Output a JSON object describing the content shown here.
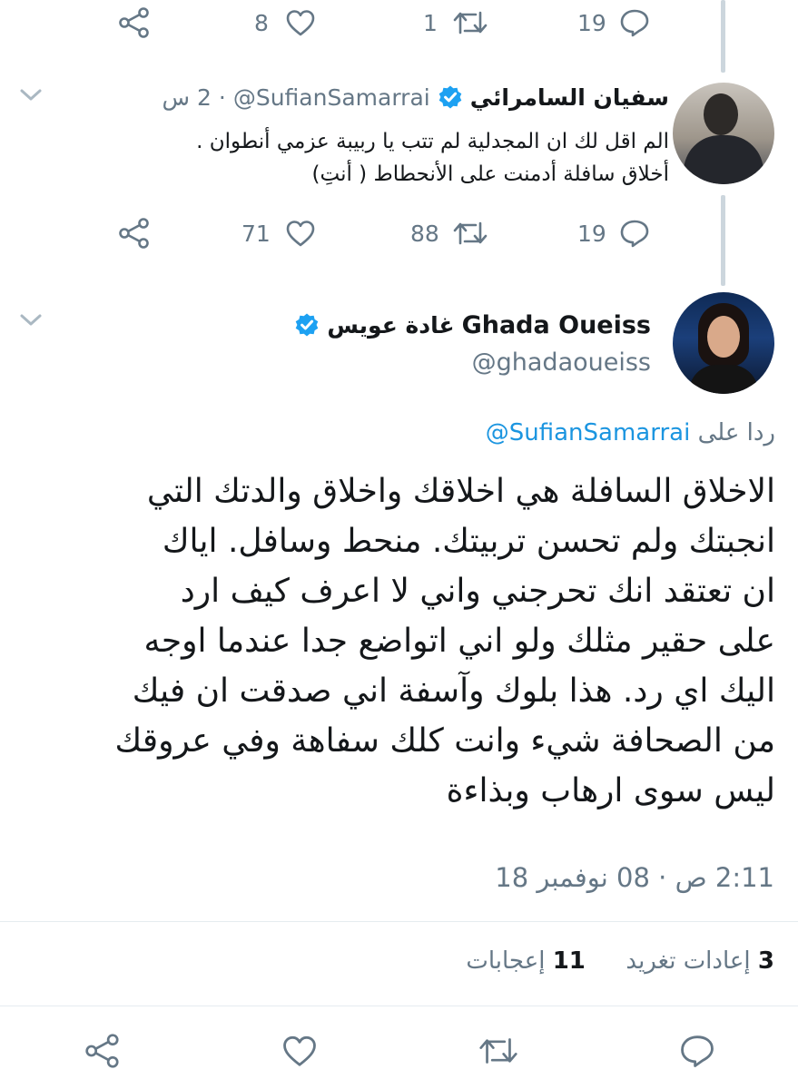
{
  "colors": {
    "accent": "#1b95e0",
    "text": "#14171a",
    "muted": "#657786",
    "divider": "#e6ecf0",
    "thread_line": "#ccd6dd"
  },
  "top_actions": {
    "reply_count": "19",
    "retweet_count": "1",
    "like_count": "8"
  },
  "reply_tweet": {
    "display_name": "سفيان السامرائي",
    "handle": "@SufianSamarrai",
    "time": "2 س",
    "separator": "·",
    "text_lines": [
      "الم اقل لك ان المجدلية لم تتب يا ربيبة عزمي أنطوان .",
      "أخلاق سافلة أدمنت على الأنحطاط ( أنتِ)"
    ],
    "reply_count": "19",
    "retweet_count": "88",
    "like_count": "71"
  },
  "main_tweet": {
    "display_name_latin": "Ghada Oueiss",
    "display_name_arabic": "غادة عويس",
    "handle": "@ghadaoueiss",
    "replying_to_label": "ردا على",
    "replying_to_handle": "@SufianSamarrai",
    "text_lines": [
      "الاخلاق السافلة هي اخلاقك واخلاق والدتك التي",
      "انجبتك ولم تحسن تربيتك. منحط وسافل. اياك",
      "ان تعتقد انك تحرجني واني لا اعرف كيف ارد",
      "على حقير مثلك ولو اني اتواضع جدا عندما اوجه",
      "اليك اي رد. هذا بلوك وآسفة اني صدقت ان فيك",
      "من الصحافة شيء وانت كلك سفاهة وفي عروقك",
      "ليس سوى ارهاب وبذاءة"
    ],
    "timestamp": "2:11 ص · 08 نوفمبر 18",
    "retweets_count": "3",
    "retweets_label": "إعادات تغريد",
    "likes_count": "11",
    "likes_label": "إعجابات"
  },
  "icons": {
    "reply": "reply-icon",
    "retweet": "retweet-icon",
    "like": "heart-icon",
    "share": "share-icon",
    "more": "chevron-down-icon",
    "verified": "verified-badge-icon"
  }
}
